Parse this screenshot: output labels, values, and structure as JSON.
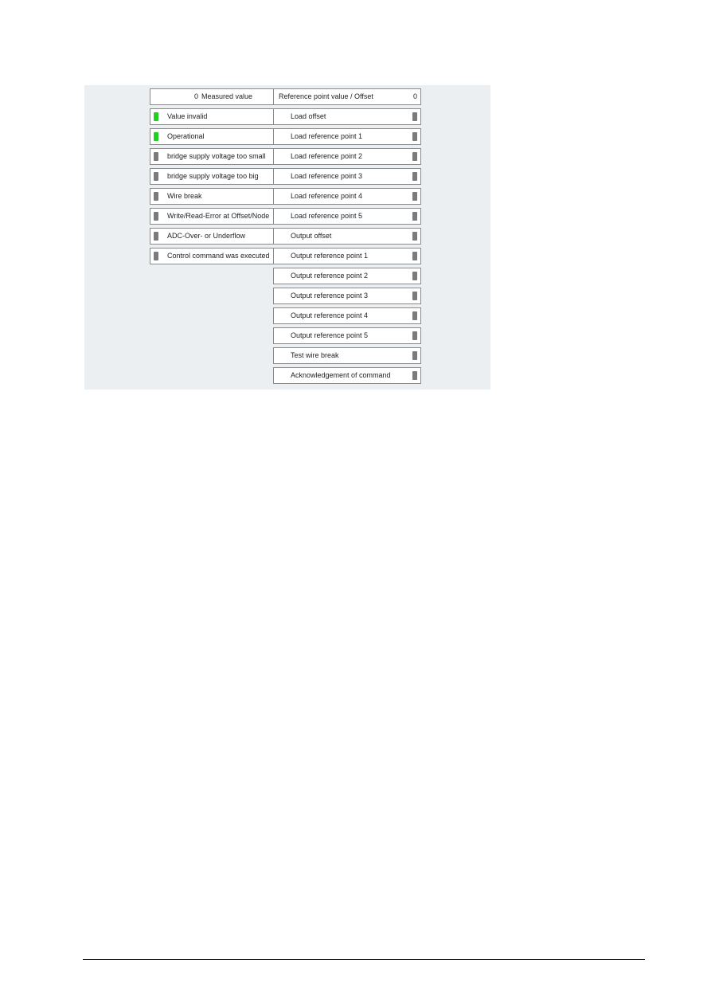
{
  "header": {
    "measured_value": "0",
    "measured_label": "Measured value",
    "reference_label": "Reference point value / Offset",
    "reference_value": "0"
  },
  "status_items": [
    {
      "label": "Value invalid",
      "state": "on",
      "color": "#22d022"
    },
    {
      "label": "Operational",
      "state": "on",
      "color": "#22d022"
    },
    {
      "label": "bridge supply voltage too small",
      "state": "off",
      "color": "#7b7b7b"
    },
    {
      "label": "bridge supply voltage too big",
      "state": "off",
      "color": "#7b7b7b"
    },
    {
      "label": "Wire break",
      "state": "off",
      "color": "#7b7b7b"
    },
    {
      "label": "Write/Read-Error at Offset/Node",
      "state": "off",
      "color": "#7b7b7b"
    },
    {
      "label": "ADC-Over- or Underflow",
      "state": "off",
      "color": "#7b7b7b"
    },
    {
      "label": "Control command was executed",
      "state": "off",
      "color": "#7b7b7b"
    }
  ],
  "command_items": [
    {
      "label": "Load offset",
      "state": "off"
    },
    {
      "label": "Load reference point 1",
      "state": "off"
    },
    {
      "label": "Load reference point 2",
      "state": "off"
    },
    {
      "label": "Load reference point 3",
      "state": "off"
    },
    {
      "label": "Load reference point 4",
      "state": "off"
    },
    {
      "label": "Load reference point 5",
      "state": "off"
    },
    {
      "label": "Output offset",
      "state": "off"
    },
    {
      "label": "Output reference point 1",
      "state": "off"
    },
    {
      "label": "Output reference point 2",
      "state": "off"
    },
    {
      "label": "Output reference point 3",
      "state": "off"
    },
    {
      "label": "Output reference point 4",
      "state": "off"
    },
    {
      "label": "Output reference point 5",
      "state": "off"
    },
    {
      "label": "Test wire break",
      "state": "off"
    },
    {
      "label": "Acknowledgement of command",
      "state": "off"
    }
  ]
}
